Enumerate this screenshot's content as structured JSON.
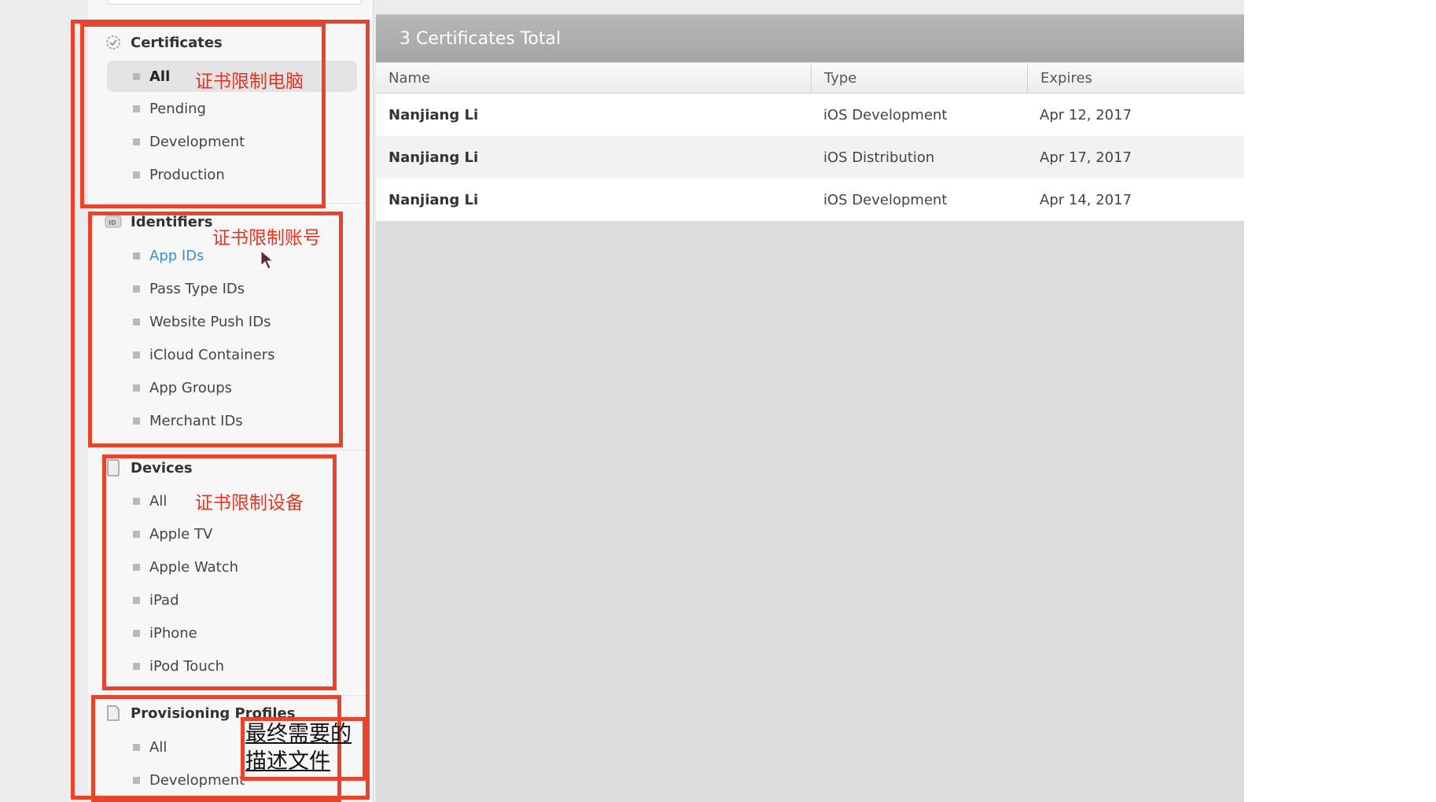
{
  "sidebar": {
    "sections": [
      {
        "title": "Certificates",
        "icon": "certificate-seal-icon",
        "items": [
          "All",
          "Pending",
          "Development",
          "Production"
        ],
        "selected": "All"
      },
      {
        "title": "Identifiers",
        "icon": "id-badge-icon",
        "items": [
          "App IDs",
          "Pass Type IDs",
          "Website Push IDs",
          "iCloud Containers",
          "App Groups",
          "Merchant IDs"
        ],
        "hovered": "App IDs"
      },
      {
        "title": "Devices",
        "icon": "device-icon",
        "items": [
          "All",
          "Apple TV",
          "Apple Watch",
          "iPad",
          "iPhone",
          "iPod Touch"
        ]
      },
      {
        "title": "Provisioning Profiles",
        "icon": "document-icon",
        "items": [
          "All",
          "Development"
        ]
      }
    ]
  },
  "main": {
    "total_label": "3 Certificates Total",
    "columns": [
      "Name",
      "Type",
      "Expires"
    ],
    "rows": [
      {
        "name": "Nanjiang Li",
        "type": "iOS Development",
        "expires": "Apr 12, 2017"
      },
      {
        "name": "Nanjiang Li",
        "type": "iOS Distribution",
        "expires": "Apr 17, 2017"
      },
      {
        "name": "Nanjiang Li",
        "type": "iOS Development",
        "expires": "Apr 14, 2017"
      }
    ]
  },
  "annotations": {
    "certificates_note": "证书限制电脑",
    "identifiers_note": "证书限制账号",
    "devices_note": "证书限制设备",
    "profiles_note_line1": "最终需要的",
    "profiles_note_line2": "描述文件"
  },
  "colors": {
    "annotation_red": "#e8442c",
    "link_blue": "#3a8fd0"
  }
}
